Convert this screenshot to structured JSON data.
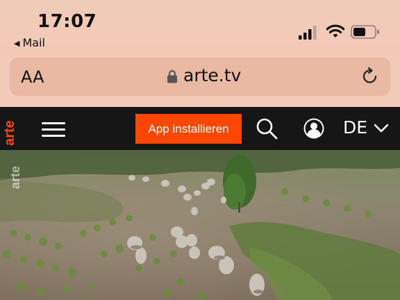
{
  "status": {
    "time": "17:07",
    "back_app": "Mail",
    "icons": [
      "cellular-signal-icon",
      "wifi-icon",
      "battery-icon"
    ]
  },
  "browser": {
    "text_size_label": "AA",
    "domain": "arte.tv",
    "icons": [
      "lock-icon",
      "reload-icon"
    ]
  },
  "site_nav": {
    "logo_text": "arte",
    "install_button": "App installieren",
    "language": "DE",
    "colors": {
      "brand": "#fd4600",
      "nav_bg": "#161616"
    },
    "icons": [
      "menu-icon",
      "search-icon",
      "user-icon",
      "chevron-down-icon"
    ]
  },
  "hero": {
    "watermark": "arte"
  }
}
